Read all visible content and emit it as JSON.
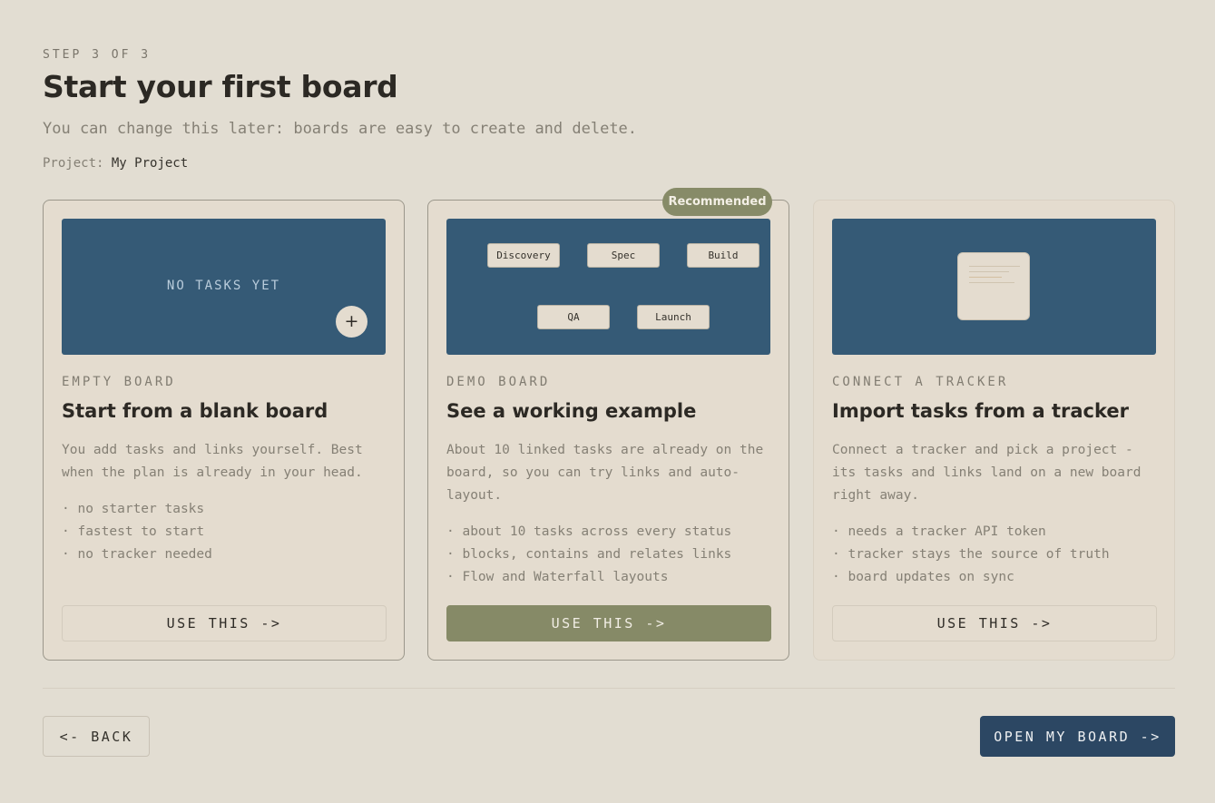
{
  "header": {
    "step": "STEP 3 OF 3",
    "title": "Start your first board",
    "subtitle": "You can change this later: boards are easy to create and delete.",
    "project_label": "Project:",
    "project_name": "My Project"
  },
  "cards": [
    {
      "kicker": "EMPTY BOARD",
      "title": "Start from a blank board",
      "description": "You add tasks and links yourself. Best when the plan is already in your head.",
      "preview_text": "NO TASKS YET",
      "plus_icon": "+",
      "bullets": [
        "no starter tasks",
        "fastest to start",
        "no tracker needed"
      ],
      "button": "USE THIS ->"
    },
    {
      "badge": "Recommended",
      "kicker": "DEMO BOARD",
      "title": "See a working example",
      "description": "About 10 linked tasks are already on the board, so you can try links and auto-layout.",
      "chips": [
        "Discovery",
        "Spec",
        "Build",
        "QA",
        "Launch"
      ],
      "bullets": [
        "about 10 tasks across every status",
        "blocks, contains and relates links",
        "Flow and Waterfall layouts"
      ],
      "button": "USE THIS ->"
    },
    {
      "kicker": "CONNECT A TRACKER",
      "title": "Import tasks from a tracker",
      "description": "Connect a tracker and pick a project - its tasks and links land on a new board right away.",
      "preview_icon": "document-icon",
      "bullets": [
        "needs a tracker API token",
        "tracker stays the source of truth",
        "board updates on sync"
      ],
      "button": "USE THIS ->"
    }
  ],
  "footer": {
    "back": "<- BACK",
    "open": "OPEN MY BOARD ->"
  },
  "colors": {
    "background": "#e2ddd2",
    "preview": "#355a76",
    "accent": "#868a67",
    "primary": "#2c4763"
  }
}
